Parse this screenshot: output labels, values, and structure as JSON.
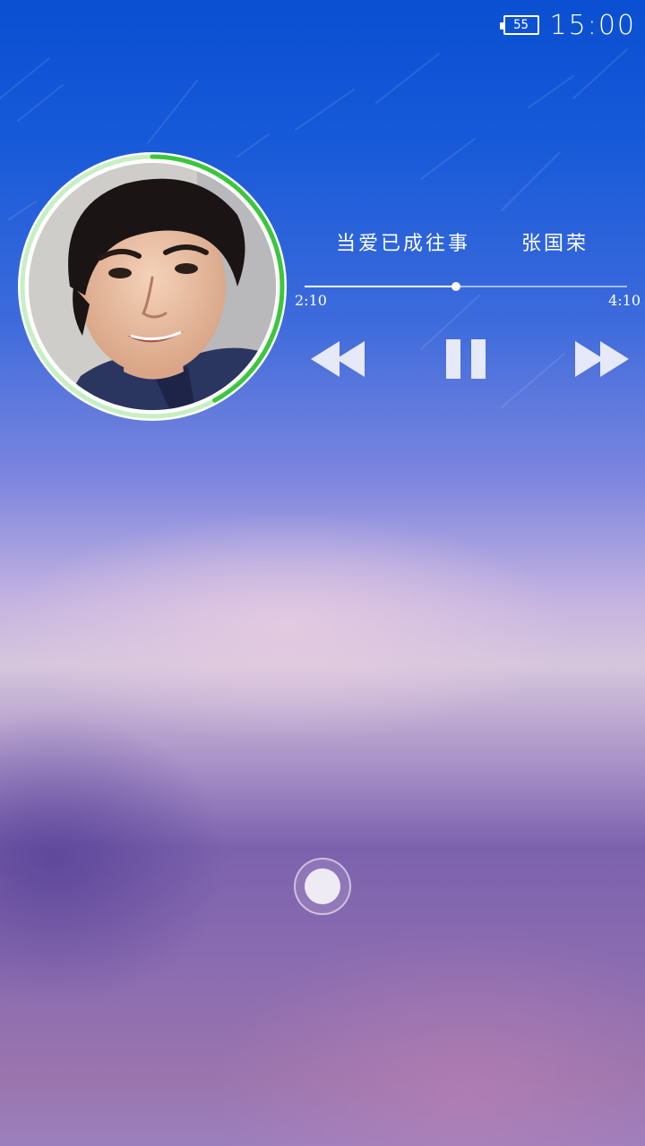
{
  "status_bar": {
    "battery_level": "55",
    "time": "15:00"
  },
  "player": {
    "song_title": "当爱已成往事",
    "artist": "张国荣",
    "elapsed": "2:10",
    "total": "4:10",
    "progress": 0.47,
    "ring_progress": 0.42,
    "accent_color": "#3cc63c"
  },
  "controls": {
    "previous_icon": "rewind-icon",
    "pause_icon": "pause-icon",
    "next_icon": "fast-forward-icon"
  },
  "home": {
    "icon": "home-button-dot"
  }
}
